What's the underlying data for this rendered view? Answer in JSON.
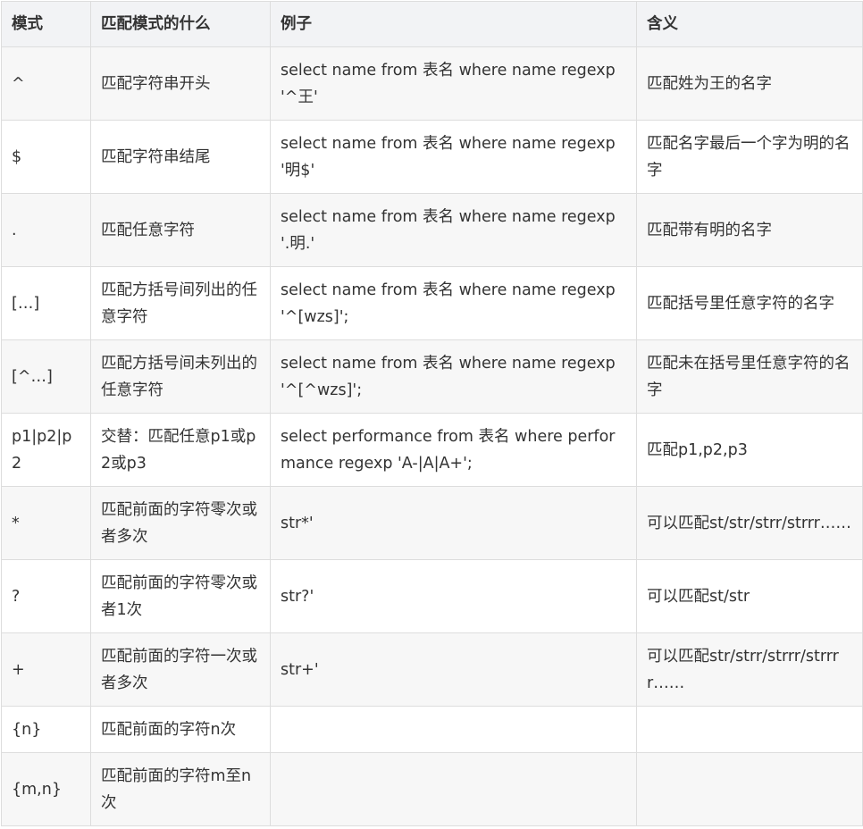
{
  "headers": [
    "模式",
    "匹配模式的什么",
    "例子",
    "含义"
  ],
  "rows": [
    {
      "pattern": "^",
      "what": "匹配字符串开头",
      "example": "select name from 表名 where name regexp '^王'",
      "meaning": "匹配姓为王的名字"
    },
    {
      "pattern": "$",
      "what": "匹配字符串结尾",
      "example": "select name from 表名 where name regexp '明$'",
      "meaning": "匹配名字最后一个字为明的名字"
    },
    {
      "pattern": ".",
      "what": "匹配任意字符",
      "example": "select name from 表名 where name regexp '.明.'",
      "meaning": "匹配带有明的名字"
    },
    {
      "pattern": "[…]",
      "what": "匹配方括号间列出的任意字符",
      "example": "select name from 表名 where name regexp '^[wzs]';",
      "meaning": "匹配括号里任意字符的名字"
    },
    {
      "pattern": "[^…]",
      "what": "匹配方括号间未列出的任意字符",
      "example": "select name from 表名 where name regexp '^[^wzs]';",
      "meaning": "匹配未在括号里任意字符的名字"
    },
    {
      "pattern": "p1|p2|p2",
      "what": "交替：匹配任意p1或p2或p3",
      "example": "select performance from 表名 where performance regexp 'A-|A|A+';",
      "meaning": "匹配p1,p2,p3"
    },
    {
      "pattern": "*",
      "what": "匹配前面的字符零次或者多次",
      "example": "str*'",
      "meaning": "可以匹配st/str/strr/strrr……"
    },
    {
      "pattern": "?",
      "what": "匹配前面的字符零次或者1次",
      "example": "str?'",
      "meaning": "可以匹配st/str"
    },
    {
      "pattern": "+",
      "what": "匹配前面的字符一次或者多次",
      "example": "str+'",
      "meaning": "可以匹配str/strr/strrr/strrrr……"
    },
    {
      "pattern": "{n}",
      "what": "匹配前面的字符n次",
      "example": "",
      "meaning": ""
    },
    {
      "pattern": "{m,n}",
      "what": "匹配前面的字符m至n次",
      "example": "",
      "meaning": ""
    }
  ]
}
